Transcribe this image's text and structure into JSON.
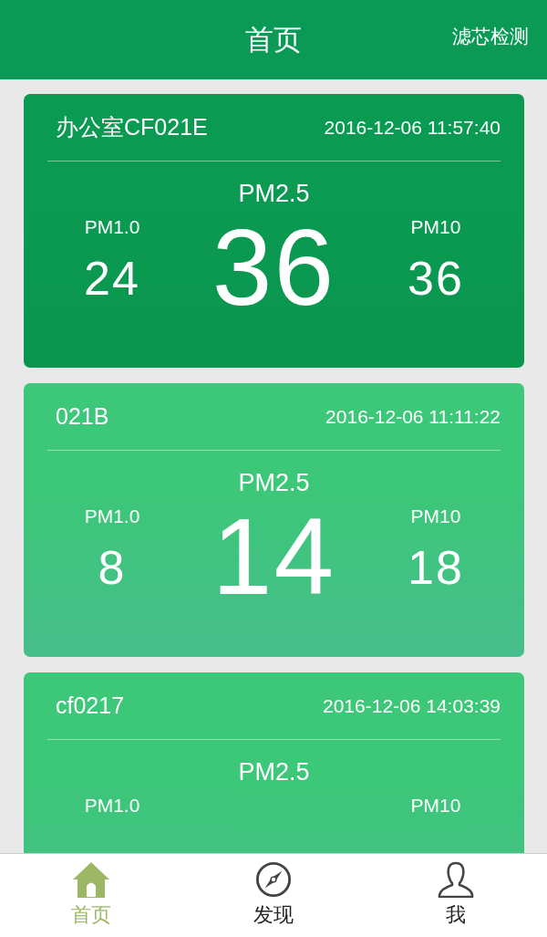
{
  "header": {
    "title": "首页",
    "action": "滤芯检测"
  },
  "devices": [
    {
      "name": "办公室CF021E",
      "time": "2016-12-06 11:57:40",
      "color": "#0b9a52",
      "main": {
        "label": "PM2.5",
        "value": "36"
      },
      "left": {
        "label": "PM1.0",
        "value": "24"
      },
      "right": {
        "label": "PM10",
        "value": "36"
      }
    },
    {
      "name": "021B",
      "time": "2016-12-06 11:11:22",
      "color": "#3cc779",
      "main": {
        "label": "PM2.5",
        "value": "14"
      },
      "left": {
        "label": "PM1.0",
        "value": "8"
      },
      "right": {
        "label": "PM10",
        "value": "18"
      }
    },
    {
      "name": "cf0217",
      "time": "2016-12-06 14:03:39",
      "color": "#3cc779",
      "main": {
        "label": "PM2.5"
      },
      "left": {
        "label": "PM1.0"
      },
      "right": {
        "label": "PM10"
      }
    }
  ],
  "tabs": [
    {
      "label": "首页",
      "kind": "home",
      "selected": true
    },
    {
      "label": "发现",
      "kind": "compass",
      "selected": false
    },
    {
      "label": "我",
      "kind": "user",
      "selected": false
    }
  ]
}
